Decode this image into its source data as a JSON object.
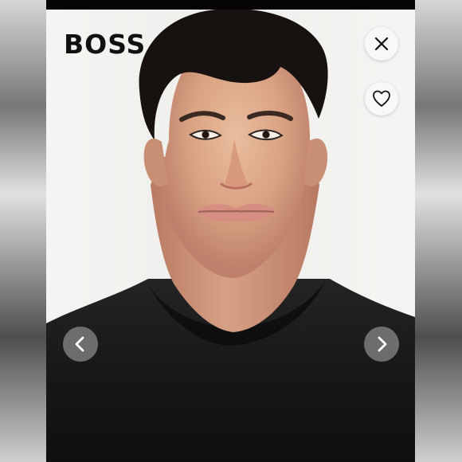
{
  "brand": {
    "name": "BOSS"
  },
  "controls": {
    "close_icon": "close-icon",
    "favorite_icon": "heart-icon",
    "previous_icon": "chevron-left-icon",
    "next_icon": "chevron-right-icon"
  },
  "colors": {
    "background_card": "#f1f1ef",
    "sweater": "#171717",
    "skin": "#d9aa8b",
    "hair": "#17120f",
    "nav_button": "#8a8a8a"
  }
}
